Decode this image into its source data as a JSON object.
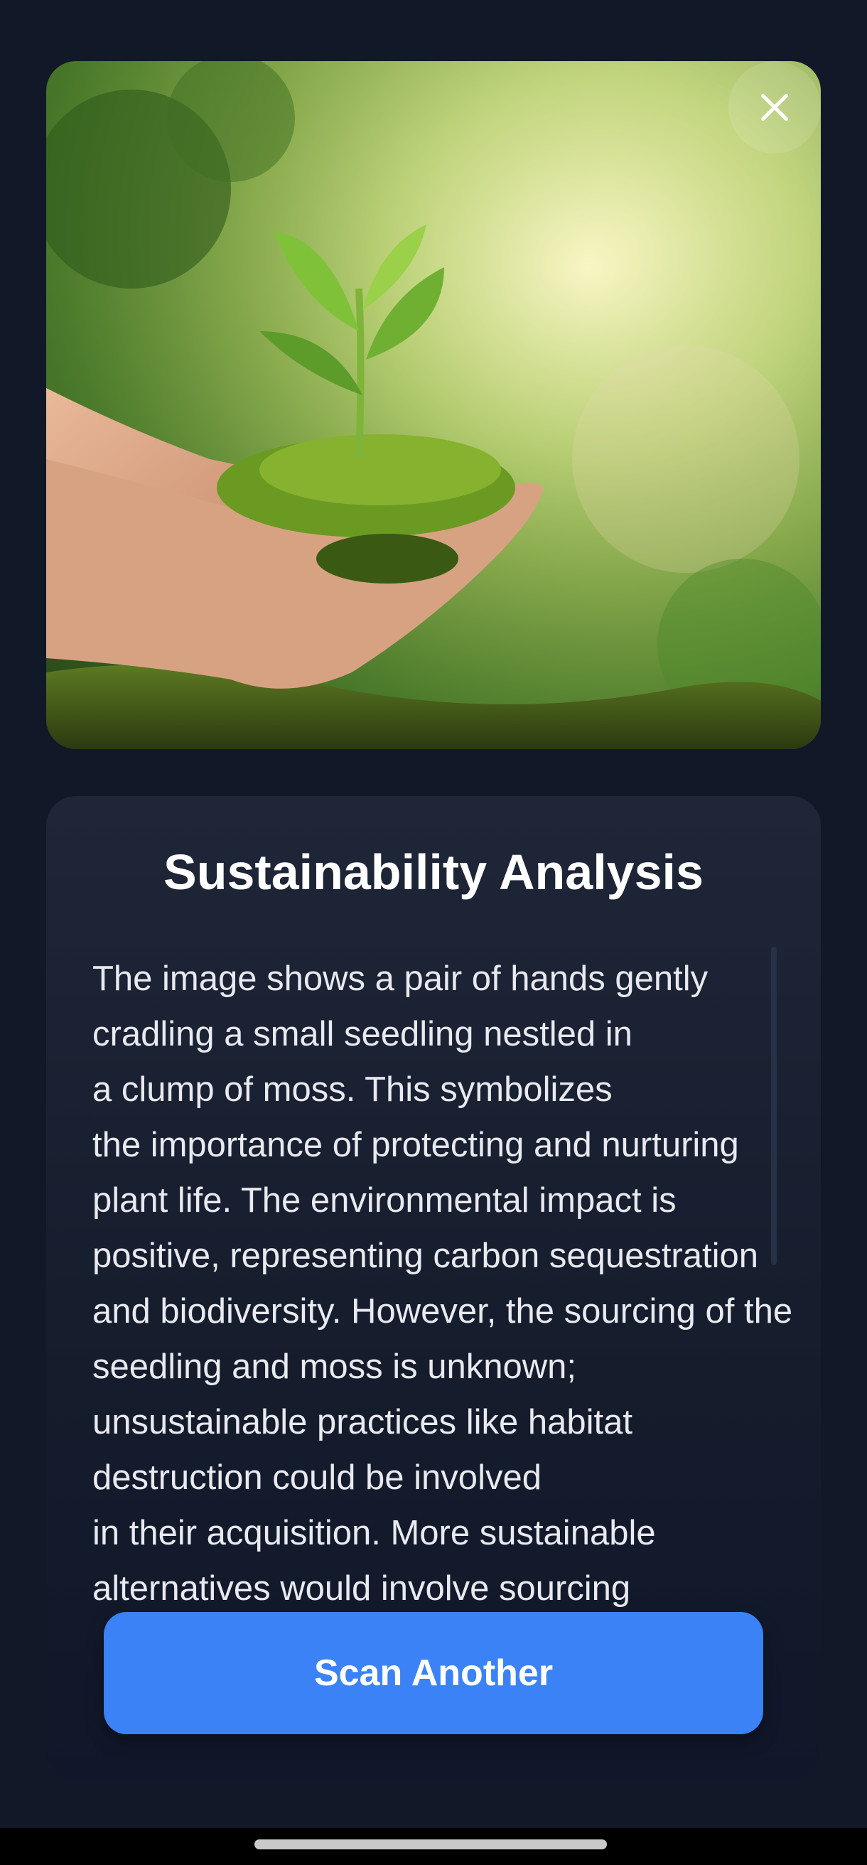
{
  "card": {
    "title": "Sustainability Analysis",
    "analysis_text": "The image shows a pair of hands gently cradling a small seedling nestled in\na clump of moss.  This symbolizes\nthe importance of protecting and nurturing plant life.  The environmental impact is positive, representing carbon sequestration and biodiversity. However, the sourcing of the seedling and moss is unknown; unsustainable practices like habitat destruction could be involved\nin their acquisition.  More sustainable alternatives would involve sourcing",
    "button_label": "Scan Another"
  },
  "icons": {
    "close": "close-icon"
  },
  "colors": {
    "background": "#111827",
    "card": "#1e2638",
    "accent": "#3b82f6",
    "text": "#ffffff"
  }
}
